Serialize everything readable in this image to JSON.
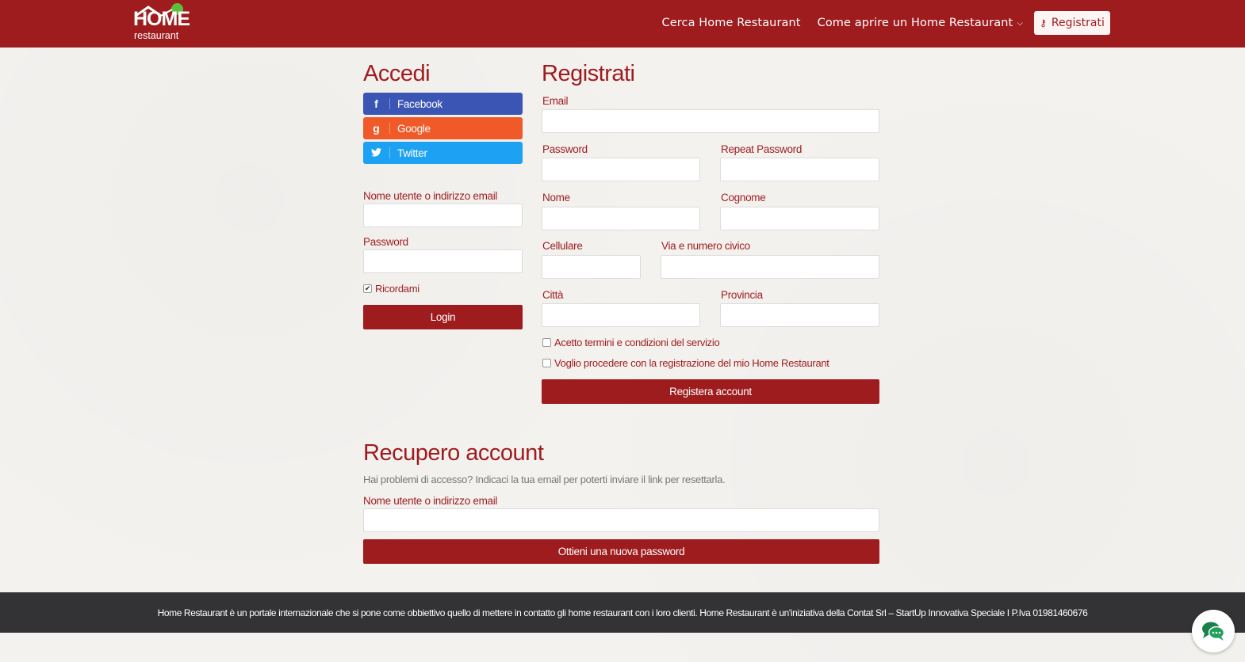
{
  "navbar": {
    "logo_home": "HOME",
    "logo_sub": "restaurant",
    "links": [
      "Cerca Home Restaurant",
      "Come aprire un Home Restaurant"
    ],
    "register_button": "Registrati",
    "color": "#9e1b1e"
  },
  "login": {
    "title": "Accedi",
    "social": [
      {
        "icon": "f",
        "label": "Facebook",
        "color": "#3b55b4"
      },
      {
        "icon": "g",
        "label": "Google",
        "color": "#f05a28"
      },
      {
        "icon": "twitter-icon",
        "label": "Twitter",
        "color": "#1da1f2"
      }
    ],
    "username_label": "Nome utente o indirizzo email",
    "password_label": "Password",
    "remember_label": "Ricordami",
    "login_button": "Login"
  },
  "register": {
    "title": "Registrati",
    "email_label": "Email",
    "password_label": "Password",
    "repeat_password_label": "Repeat Password",
    "name_label": "Nome",
    "surname_label": "Cognome",
    "phone_label": "Cellulare",
    "address_label": "Via e numero civico",
    "city_label": "Città",
    "province_label": "Provincia",
    "terms_label": "Acetto termini e condizioni del servizio",
    "proceed_label": "Voglio procedere con la registrazione del mio Home Restaurant",
    "submit_button": "Registera account"
  },
  "recovery": {
    "title": "Recupero account",
    "hint": "Hai problemi di accesso? Indicaci la tua email per poterti inviare il link per resettarla.",
    "username_label": "Nome utente o indirizzo email",
    "submit_button": "Ottieni una nuova password"
  },
  "footer": {
    "text": "Home Restaurant è un portale internazionale che si pone come obbiettivo quello di mettere in contatto gli home restaurant con i loro clienti. Home Restaurant è un'iniziativa della Contat Srl – StartUp Innovativa Speciale I P.Iva 01981460676"
  }
}
